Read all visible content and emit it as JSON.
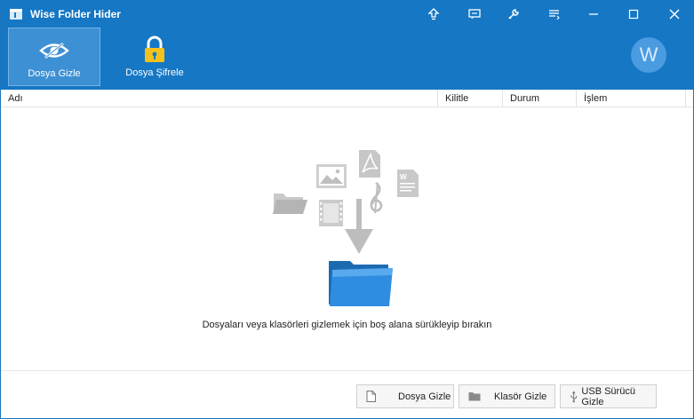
{
  "window": {
    "title": "Wise Folder Hider"
  },
  "toolbar": {
    "tools": [
      {
        "label": "Dosya Gizle"
      },
      {
        "label": "Dosya Şifrele"
      }
    ],
    "avatar_letter": "W"
  },
  "table": {
    "columns": [
      "Adı",
      "Kilitle",
      "Durum",
      "İşlem"
    ]
  },
  "main": {
    "hint": "Dosyaları veya klasörleri gizlemek için boş alana sürükleyip bırakın"
  },
  "footer": {
    "buttons": [
      {
        "label": "Dosya Gizle",
        "icon": "file-icon"
      },
      {
        "label": "Klasör Gizle",
        "icon": "folder-icon"
      },
      {
        "label": "USB Sürücü Gizle",
        "icon": "usb-icon"
      }
    ]
  },
  "colors": {
    "header": "#1677c4",
    "active_tool": "#3d90d4",
    "folder": "#2e8de0"
  }
}
